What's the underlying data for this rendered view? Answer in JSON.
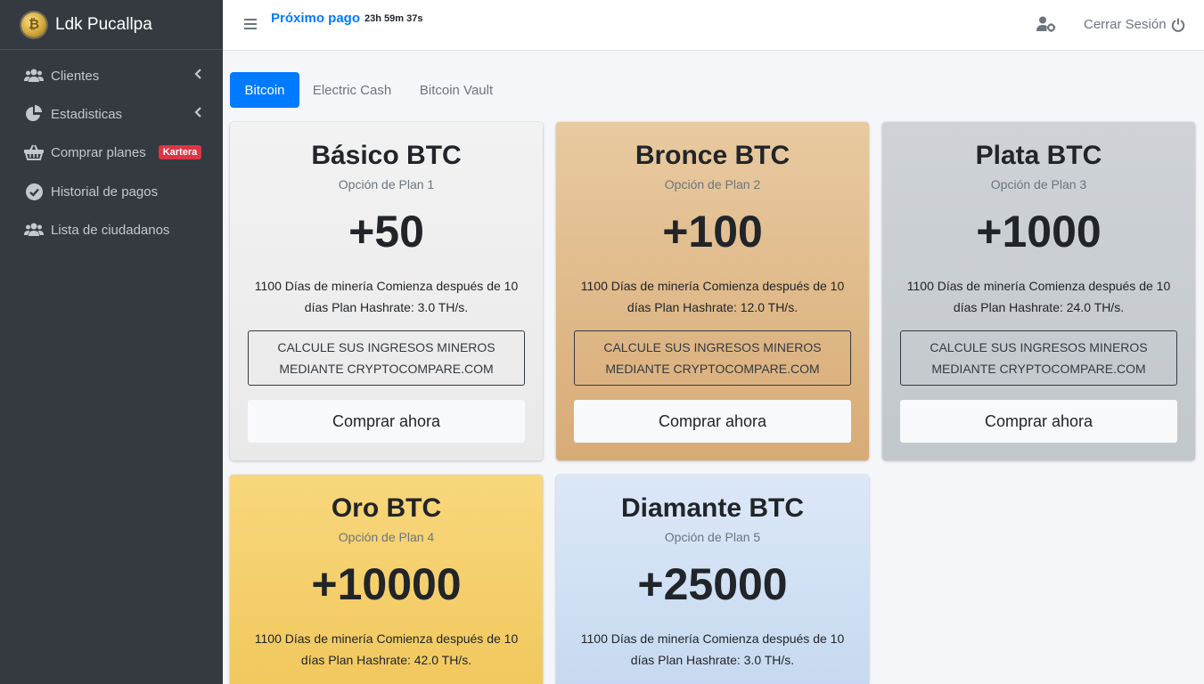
{
  "sidebar": {
    "brand": "Ldk Pucallpa",
    "items": [
      {
        "label": "Clientes"
      },
      {
        "label": "Estadisticas"
      },
      {
        "label": "Comprar planes",
        "badge": "Kartera"
      },
      {
        "label": "Historial de pagos"
      },
      {
        "label": "Lista de ciudadanos"
      }
    ]
  },
  "header": {
    "next_payment_label": "Próximo pago",
    "countdown": "23h 59m 37s",
    "logout_label": "Cerrar Sesión"
  },
  "tabs": [
    {
      "label": "Bitcoin",
      "active": true
    },
    {
      "label": "Electric Cash",
      "active": false
    },
    {
      "label": "Bitcoin Vault",
      "active": false
    }
  ],
  "plans": [
    {
      "title": "Básico BTC",
      "subtitle": "Opción de Plan 1",
      "amount": "+50",
      "description": "1100 Días de minería Comienza después de 10 días Plan Hashrate: 3.0 TH/s.",
      "calc": "CALCULE SUS INGRESOS MINEROS MEDIANTE CRYPTOCOMPARE.COM",
      "buy": "Comprar ahora"
    },
    {
      "title": "Bronce BTC",
      "subtitle": "Opción de Plan 2",
      "amount": "+100",
      "description": "1100 Días de minería Comienza después de 10 días Plan Hashrate: 12.0 TH/s.",
      "calc": "CALCULE SUS INGRESOS MINEROS MEDIANTE CRYPTOCOMPARE.COM",
      "buy": "Comprar ahora"
    },
    {
      "title": "Plata BTC",
      "subtitle": "Opción de Plan 3",
      "amount": "+1000",
      "description": "1100 Días de minería Comienza después de 10 días Plan Hashrate: 24.0 TH/s.",
      "calc": "CALCULE SUS INGRESOS MINEROS MEDIANTE CRYPTOCOMPARE.COM",
      "buy": "Comprar ahora"
    },
    {
      "title": "Oro BTC",
      "subtitle": "Opción de Plan 4",
      "amount": "+10000",
      "description": "1100 Días de minería Comienza después de 10 días Plan Hashrate: 42.0 TH/s."
    },
    {
      "title": "Diamante BTC",
      "subtitle": "Opción de Plan 5",
      "amount": "+25000",
      "description": "1100 Días de minería Comienza después de 10 días Plan Hashrate: 3.0 TH/s."
    }
  ],
  "colors": {
    "sidebar_bg": "#343a40",
    "primary": "#007bff",
    "badge": "#dc3545"
  }
}
